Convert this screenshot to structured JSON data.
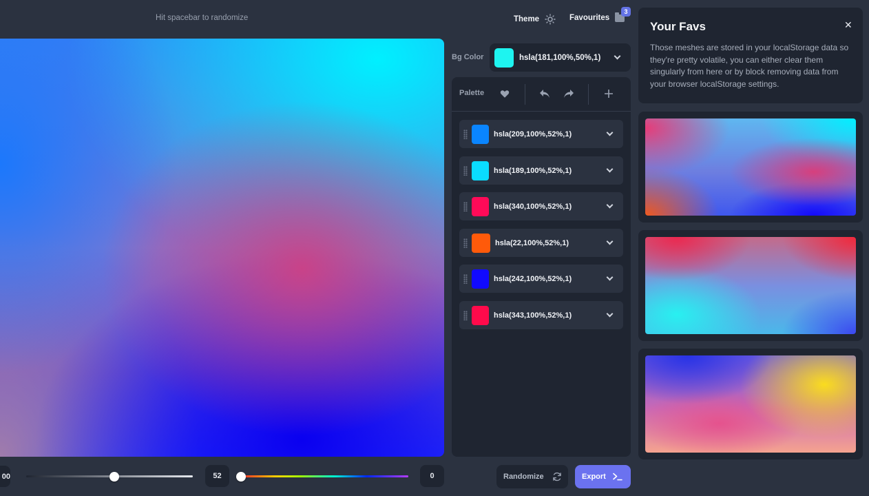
{
  "header": {
    "hint": "Hit spacebar to randomize",
    "theme_label": "Theme",
    "favourites_label": "Favourites",
    "favourites_count": "3"
  },
  "sliders": {
    "left_value_partial": "00",
    "lightness_value": "52",
    "hue_value": "0"
  },
  "bg_color": {
    "label": "Bg Color",
    "value": "hsla(181,100%,50%,1)",
    "swatch": "#1ef4f0"
  },
  "palette": {
    "label": "Palette",
    "items": [
      {
        "value": "hsla(209,100%,52%,1)",
        "swatch": "#0a85ff"
      },
      {
        "value": "hsla(189,100%,52%,1)",
        "swatch": "#0adcff"
      },
      {
        "value": "hsla(340,100%,52%,1)",
        "swatch": "#ff0a58"
      },
      {
        "value": "hsla(22,100%,52%,1)",
        "swatch": "#ff5a0a"
      },
      {
        "value": "hsla(242,100%,52%,1)",
        "swatch": "#110aff"
      },
      {
        "value": "hsla(343,100%,52%,1)",
        "swatch": "#ff0a4b"
      }
    ]
  },
  "actions": {
    "randomize_label": "Randomize",
    "export_label": "Export"
  },
  "favs_panel": {
    "title": "Your Favs",
    "description": "Those meshes are stored in your localStorage data so they're pretty volatile, you can either clear them singularly from here or by block removing data from your browser localStorage settings."
  },
  "colors": {
    "accent": "#6b72ef",
    "panel": "#1f2531",
    "background": "#2b3240"
  }
}
